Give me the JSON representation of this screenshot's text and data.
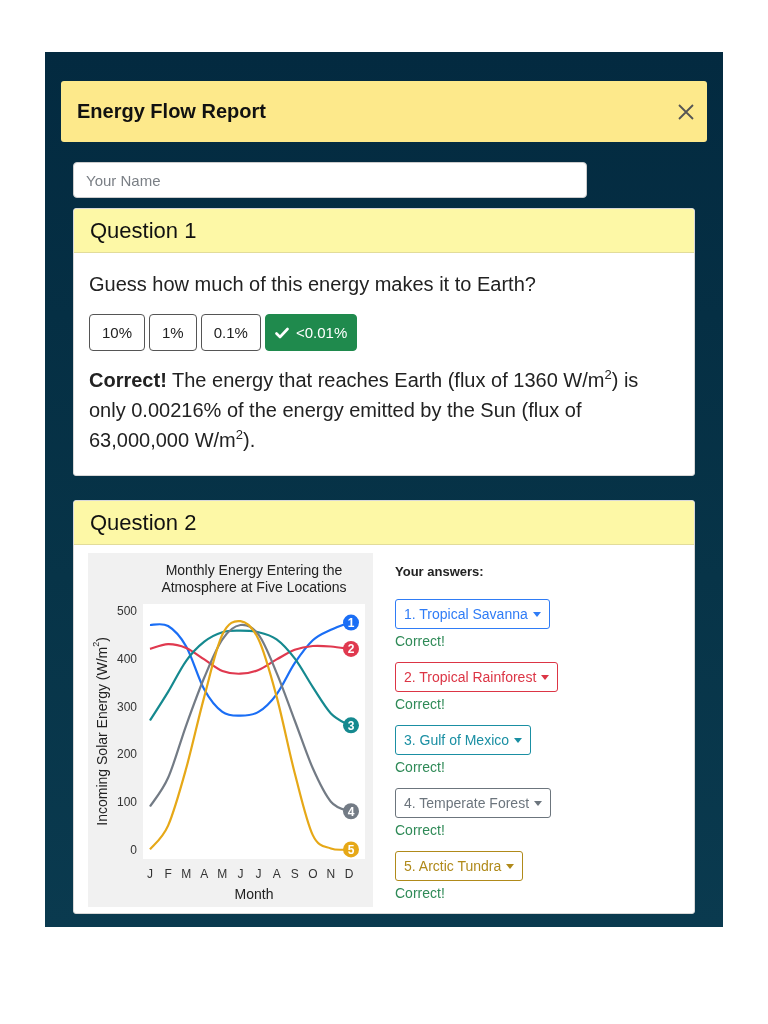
{
  "report": {
    "title": "Energy Flow Report"
  },
  "name_field": {
    "placeholder": "Your Name"
  },
  "questions": [
    {
      "kind": "choice",
      "title": "Question 1",
      "prompt": "Guess how much of this energy makes it to Earth?",
      "options": [
        {
          "label": "10%",
          "selected": false
        },
        {
          "label": "1%",
          "selected": false
        },
        {
          "label": "0.1%",
          "selected": false
        },
        {
          "label": "<0.01%",
          "selected": true
        }
      ],
      "feedback": "**Correct!** The energy that reaches Earth (flux of 1360 W/m$^{2}$) is only 0.00216% of the energy emitted by the Sun (flux of 63,000,000 W/m$^{2}$)."
    },
    {
      "kind": "chart_match",
      "title": "Question 2",
      "chart_data": {
        "type": "line",
        "title": "Monthly Energy Entering the Atmosphere at Five Locations",
        "xlabel": "Month",
        "ylabel": "Incoming Solar Energy (W/m$^{2}$)",
        "categories": [
          "J",
          "F",
          "M",
          "A",
          "M",
          "J",
          "J",
          "A",
          "S",
          "O",
          "N",
          "D"
        ],
        "ylim": [
          -20,
          514
        ],
        "yticks": [
          0,
          100,
          200,
          300,
          400,
          500
        ],
        "series": [
          {
            "name": "1",
            "color": "#1a6ef5",
            "values": [
              470,
              468,
              425,
              335,
              288,
              280,
              288,
              325,
              390,
              438,
              460,
              475
            ]
          },
          {
            "name": "2",
            "color": "#e0394f",
            "values": [
              420,
              430,
              422,
              398,
              374,
              368,
              376,
              398,
              418,
              426,
              425,
              420
            ]
          },
          {
            "name": "3",
            "color": "#15898f",
            "values": [
              270,
              330,
              395,
              435,
              455,
              458,
              455,
              440,
              400,
              340,
              285,
              260
            ]
          },
          {
            "name": "4",
            "color": "#737b85",
            "values": [
              90,
              150,
              260,
              360,
              440,
              470,
              450,
              370,
              270,
              170,
              100,
              80
            ]
          },
          {
            "name": "5",
            "color": "#e6a817",
            "values": [
              0,
              50,
              170,
              320,
              450,
              478,
              440,
              320,
              160,
              30,
              2,
              0
            ]
          }
        ]
      },
      "answers_label": "Your answers:",
      "answers": [
        {
          "label": "1. Tropical Savanna",
          "color": "#2f7cf6",
          "result": "Correct!",
          "correct": true
        },
        {
          "label": "2. Tropical Rainforest",
          "color": "#dc3545",
          "result": "Correct!",
          "correct": true
        },
        {
          "label": "3. Gulf of Mexico",
          "color": "#1a8fa3",
          "result": "Correct!",
          "correct": true
        },
        {
          "label": "4. Temperate Forest",
          "color": "#6c757d",
          "result": "Correct!",
          "correct": true
        },
        {
          "label": "5. Arctic Tundra",
          "color": "#b08a1a",
          "result": "Correct!",
          "correct": true
        }
      ]
    }
  ]
}
